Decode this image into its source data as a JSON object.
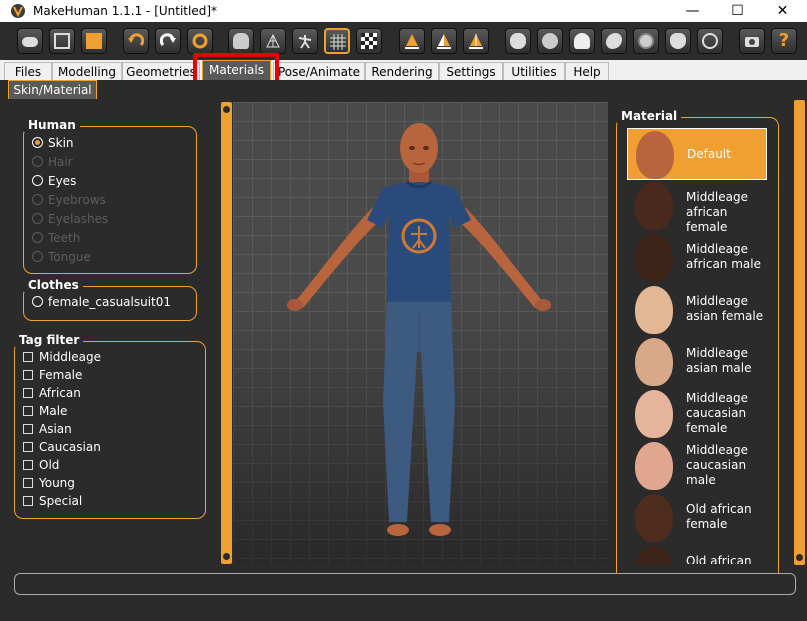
{
  "window": {
    "title": "MakeHuman 1.1.1 - [Untitled]*",
    "controls": [
      "—",
      "☐",
      "✕"
    ]
  },
  "toolbar": {
    "icons": [
      "undo-icon",
      "save-icon",
      "export-icon",
      "undo-arrow-icon",
      "redo-arrow-icon",
      "reset-icon",
      "smooth-icon",
      "wireframe-icon",
      "pose-icon",
      "background-grid-icon",
      "checker-icon",
      "front-view-icon",
      "left-view-icon",
      "top-view-icon",
      "face-icon",
      "head-icon",
      "hair-icon",
      "eyebrow-icon",
      "eye-icon",
      "lips-icon",
      "frame-icon",
      "screenshot-icon",
      "help-icon"
    ],
    "help_label": "?"
  },
  "tabs": {
    "items": [
      "Files",
      "Modelling",
      "Geometries",
      "Materials",
      "Pose/Animate",
      "Rendering",
      "Settings",
      "Utilities",
      "Help"
    ],
    "active": "Materials"
  },
  "subtabs": {
    "items": [
      "Skin/Material"
    ]
  },
  "human_group": {
    "title": "Human",
    "options": [
      {
        "label": "Skin",
        "selected": true,
        "enabled": true
      },
      {
        "label": "Hair",
        "selected": false,
        "enabled": false
      },
      {
        "label": "Eyes",
        "selected": false,
        "enabled": true
      },
      {
        "label": "Eyebrows",
        "selected": false,
        "enabled": false
      },
      {
        "label": "Eyelashes",
        "selected": false,
        "enabled": false
      },
      {
        "label": "Teeth",
        "selected": false,
        "enabled": false
      },
      {
        "label": "Tongue",
        "selected": false,
        "enabled": false
      }
    ]
  },
  "clothes_group": {
    "title": "Clothes",
    "options": [
      {
        "label": "female_casualsuit01",
        "selected": false
      }
    ]
  },
  "tag_filter": {
    "title": "Tag filter",
    "tags": [
      "Middleage",
      "Female",
      "African",
      "Male",
      "Asian",
      "Caucasian",
      "Old",
      "Young",
      "Special"
    ]
  },
  "material_panel": {
    "title": "Material",
    "items": [
      {
        "label": "Default",
        "selected": true,
        "skin": "#b8653e"
      },
      {
        "label": "Middleage african female",
        "selected": false,
        "skin": "#4a2a1c"
      },
      {
        "label": "Middleage african male",
        "selected": false,
        "skin": "#3e2418"
      },
      {
        "label": "Middleage asian female",
        "selected": false,
        "skin": "#e3b694"
      },
      {
        "label": "Middleage asian male",
        "selected": false,
        "skin": "#d9a888"
      },
      {
        "label": "Middleage caucasian female",
        "selected": false,
        "skin": "#e6b49c"
      },
      {
        "label": "Middleage caucasian male",
        "selected": false,
        "skin": "#e0a690"
      },
      {
        "label": "Old african female",
        "selected": false,
        "skin": "#4e2c1e"
      },
      {
        "label": "Old african",
        "selected": false,
        "skin": "#3f2519"
      }
    ]
  },
  "colors": {
    "accent": "#f0a030",
    "highlight_box": "#e60000",
    "shirt": "#2b4a7c",
    "jeans": "#3d5b80"
  }
}
